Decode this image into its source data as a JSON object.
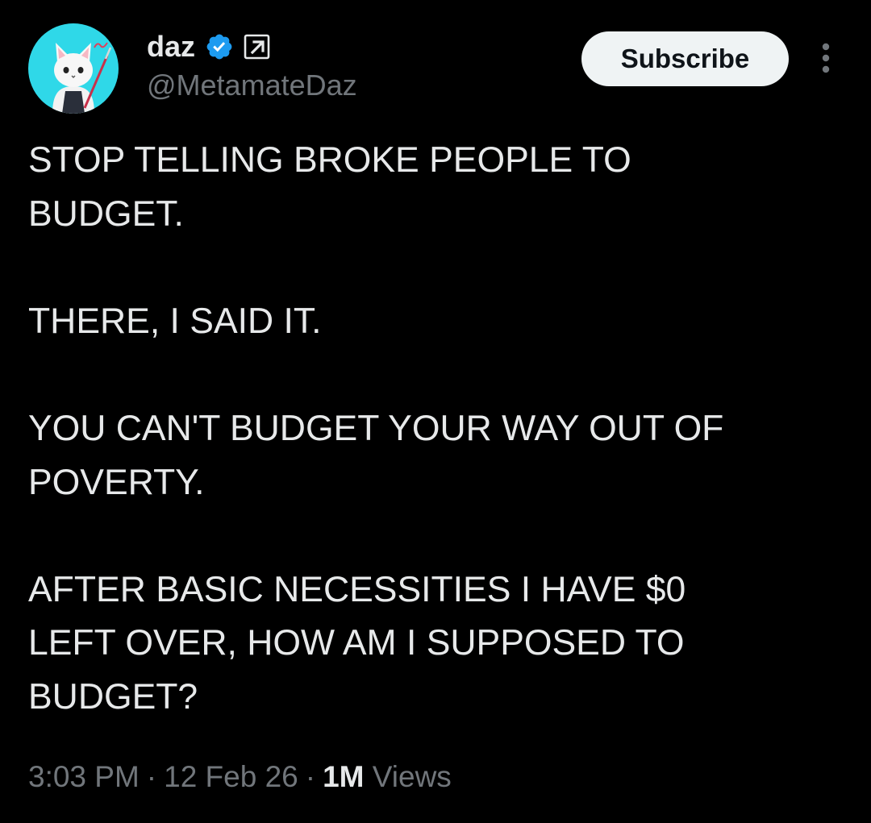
{
  "author": {
    "display_name": "daz",
    "handle": "@MetamateDaz",
    "avatar": "cat-character-avatar",
    "verified_icon": "verified-badge-icon",
    "affiliate_icon": "external-link-arrow-icon"
  },
  "actions": {
    "subscribe_label": "Subscribe",
    "more_icon": "more-vertical-icon"
  },
  "tweet": {
    "text": "STOP TELLING BROKE PEOPLE TO\nBUDGET.\n\nTHERE, I SAID IT.\n\nYOU CAN'T BUDGET YOUR WAY OUT OF\nPOVERTY.\n\nAFTER BASIC NECESSITIES I HAVE $0\nLEFT OVER, HOW AM I SUPPOSED TO\nBUDGET?"
  },
  "meta": {
    "time": "3:03 PM",
    "date": "12 Feb 26",
    "separator": "·",
    "views_count": "1M",
    "views_label": "Views"
  },
  "colors": {
    "background": "#000000",
    "text_primary": "#e7e9ea",
    "text_secondary": "#71767b",
    "verified_blue": "#1d9bf0",
    "avatar_bg": "#2fd8e8",
    "button_bg": "#eff3f4"
  }
}
